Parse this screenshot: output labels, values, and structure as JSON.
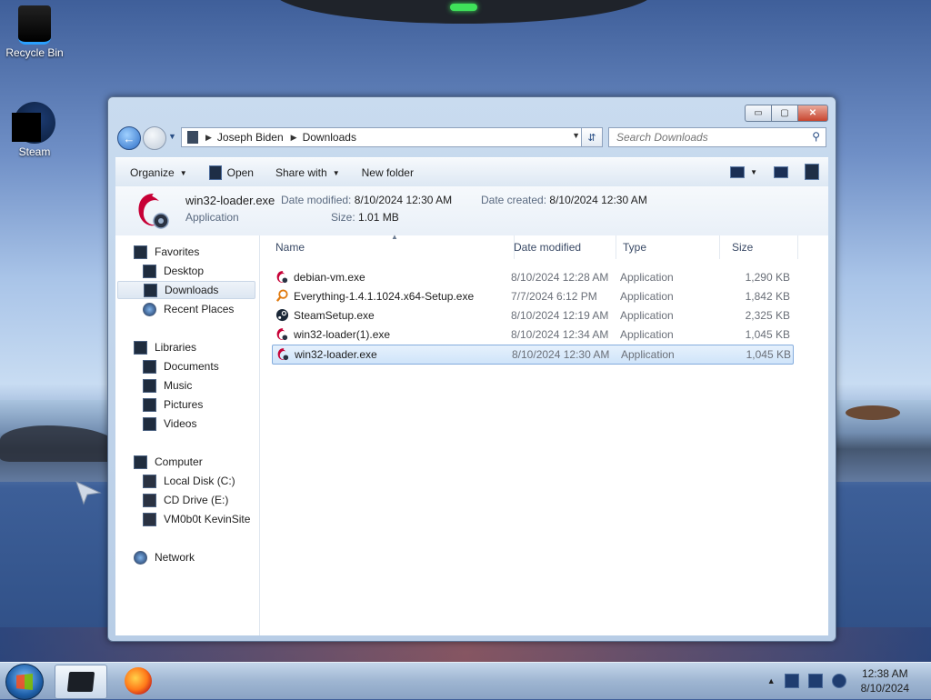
{
  "desktop": {
    "icons": [
      {
        "label": "Recycle Bin"
      },
      {
        "label": "Steam"
      }
    ]
  },
  "window": {
    "controls": {
      "minimize": "▭",
      "maximize": "▢",
      "close": "✕"
    },
    "address": {
      "crumbs": [
        "Joseph Biden",
        "Downloads"
      ]
    },
    "search": {
      "placeholder": "Search Downloads"
    },
    "toolbar": {
      "organize": "Organize",
      "open": "Open",
      "share_with": "Share with",
      "new_folder": "New folder"
    },
    "details": {
      "name": "win32-loader.exe",
      "type": "Application",
      "date_modified_label": "Date modified:",
      "date_modified": "8/10/2024 12:30 AM",
      "date_created_label": "Date created:",
      "date_created": "8/10/2024 12:30 AM",
      "size_label": "Size:",
      "size": "1.01 MB"
    },
    "nav": {
      "favorites": "Favorites",
      "desktop": "Desktop",
      "downloads": "Downloads",
      "recent_places": "Recent Places",
      "libraries": "Libraries",
      "documents": "Documents",
      "music": "Music",
      "pictures": "Pictures",
      "videos": "Videos",
      "computer": "Computer",
      "local_disk": "Local Disk (C:)",
      "cd_drive": "CD Drive (E:)",
      "vm_share": "VM0b0t KevinSite",
      "network": "Network"
    },
    "columns": {
      "name": "Name",
      "date_modified": "Date modified",
      "type": "Type",
      "size": "Size"
    },
    "files": [
      {
        "name": "debian-vm.exe",
        "date": "8/10/2024 12:28 AM",
        "type": "Application",
        "size": "1,290 KB",
        "icon": "debian-icon"
      },
      {
        "name": "Everything-1.4.1.1024.x64-Setup.exe",
        "date": "7/7/2024 6:12 PM",
        "type": "Application",
        "size": "1,842 KB",
        "icon": "magnifier-icon"
      },
      {
        "name": "SteamSetup.exe",
        "date": "8/10/2024 12:19 AM",
        "type": "Application",
        "size": "2,325 KB",
        "icon": "steam-icon"
      },
      {
        "name": "win32-loader(1).exe",
        "date": "8/10/2024 12:34 AM",
        "type": "Application",
        "size": "1,045 KB",
        "icon": "debian-icon"
      },
      {
        "name": "win32-loader.exe",
        "date": "8/10/2024 12:30 AM",
        "type": "Application",
        "size": "1,045 KB",
        "icon": "debian-icon",
        "selected": true
      }
    ]
  },
  "taskbar": {
    "time": "12:38 AM",
    "date": "8/10/2024"
  },
  "colors": {
    "selection": "#cfe4fa",
    "debian_red": "#c70036"
  }
}
